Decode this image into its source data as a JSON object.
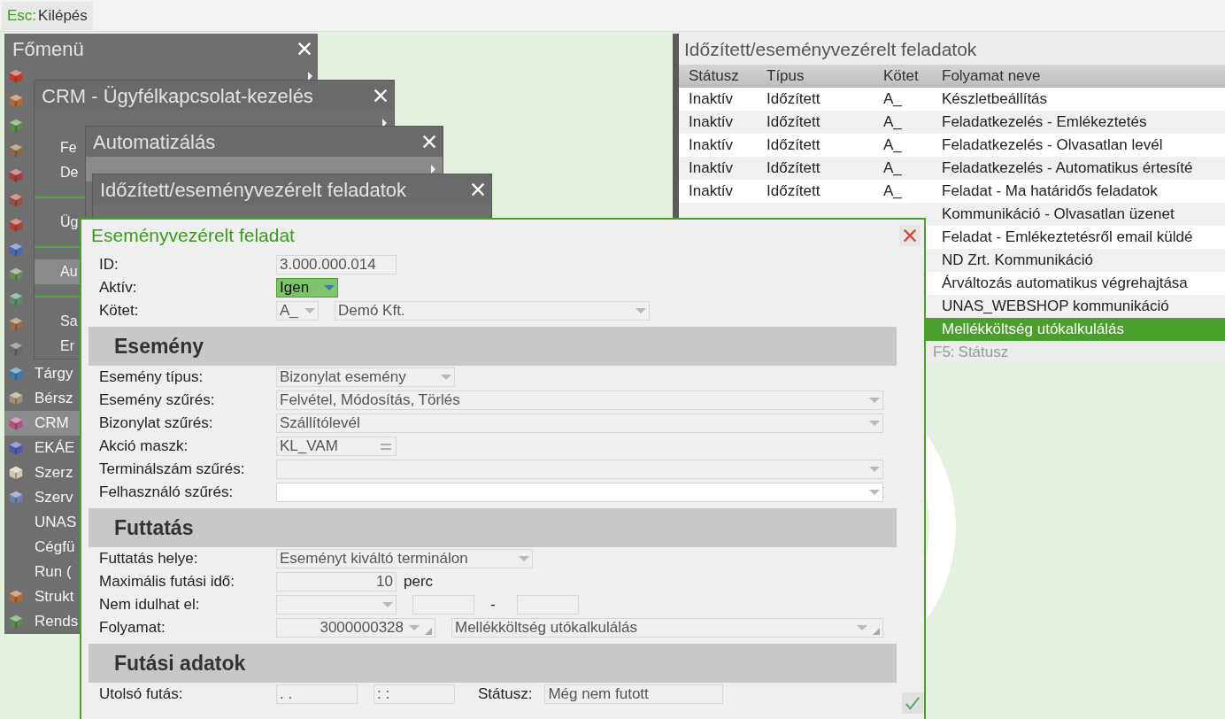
{
  "topbar": {
    "key": "Esc:",
    "label": "Kilépés"
  },
  "main_menu": {
    "title": "Főmenü",
    "items": [
      {
        "icon": true,
        "arrow": true,
        "selected": false
      },
      {
        "icon": true,
        "selected": false
      },
      {
        "icon": true,
        "selected": false
      },
      {
        "icon": true,
        "selected": false
      },
      {
        "icon": true,
        "selected": false
      },
      {
        "icon": true,
        "selected": false
      },
      {
        "icon": true,
        "selected": false
      },
      {
        "icon": true,
        "selected": false
      },
      {
        "icon": true,
        "selected": false
      },
      {
        "icon": true,
        "selected": false
      },
      {
        "icon": true,
        "selected": false
      },
      {
        "icon": true,
        "selected": false
      },
      {
        "label": "Tárgy",
        "icon": true,
        "selected": false
      },
      {
        "label": "Bérsz",
        "icon": true,
        "selected": false
      },
      {
        "label": "CRM",
        "icon": true,
        "selected": true
      },
      {
        "label": "EKÁE",
        "icon": true,
        "selected": false
      },
      {
        "label": "Szerz",
        "icon": true,
        "selected": false
      },
      {
        "label": "Szerv",
        "icon": true,
        "selected": false
      },
      {
        "label": "UNAS",
        "icon": false,
        "selected": false
      },
      {
        "label": "Cégfü",
        "icon": false,
        "selected": false
      },
      {
        "label": "Run (",
        "icon": false,
        "selected": false
      },
      {
        "label": "Strukt",
        "icon": true,
        "selected": false
      },
      {
        "label": "Rends",
        "icon": true,
        "selected": false
      }
    ]
  },
  "crm_menu": {
    "title": "CRM - Ügyfélkapcsolat-kezelés",
    "items": [
      {
        "kind": "item",
        "arrow": true,
        "selected": false
      },
      {
        "kind": "item",
        "label": "Fe",
        "selected": false
      },
      {
        "kind": "item",
        "label": "De",
        "selected": false
      },
      {
        "kind": "separator"
      },
      {
        "kind": "item",
        "label": "Üg",
        "selected": false
      },
      {
        "kind": "separator"
      },
      {
        "kind": "item",
        "label": "Au",
        "selected": true
      },
      {
        "kind": "separator"
      },
      {
        "kind": "item",
        "label": "Sa",
        "selected": false
      },
      {
        "kind": "item",
        "label": "Er",
        "selected": false
      }
    ]
  },
  "automation_menu": {
    "title": "Automatizálás",
    "items": [
      {
        "arrow": true,
        "selected": true
      }
    ]
  },
  "tasks_menu": {
    "title": "Időzített/eseményvezérelt feladatok",
    "items": [
      {
        "selected": false
      }
    ]
  },
  "task_list": {
    "title": "Időzített/eseményvezérelt feladatok",
    "columns": [
      "Státusz",
      "Típus",
      "Kötet",
      "Folyamat neve"
    ],
    "rows": [
      {
        "cells": [
          "Inaktív",
          "Időzített",
          "A_",
          "Készletbeállítás"
        ],
        "selected": false
      },
      {
        "cells": [
          "Inaktív",
          "Időzített",
          "A_",
          "Feladatkezelés - Emlékeztetés"
        ],
        "selected": false
      },
      {
        "cells": [
          "Inaktív",
          "Időzített",
          "A_",
          "Feladatkezelés - Olvasatlan levél"
        ],
        "selected": false
      },
      {
        "cells": [
          "Inaktív",
          "Időzített",
          "A_",
          "Feladatkezelés - Automatikus értesíté"
        ],
        "selected": false
      },
      {
        "cells": [
          "Inaktív",
          "Időzített",
          "A_",
          "Feladat - Ma határidős feladatok"
        ],
        "selected": false
      },
      {
        "cells": [
          null,
          null,
          null,
          "Kommunikáció - Olvasatlan üzenet"
        ],
        "selected": false
      },
      {
        "cells": [
          null,
          null,
          null,
          "Feladat - Emlékeztetésről email küldé"
        ],
        "selected": false
      },
      {
        "cells": [
          null,
          null,
          null,
          "ND Zrt. Kommunikáció"
        ],
        "selected": false
      },
      {
        "cells": [
          null,
          null,
          null,
          "Árváltozás automatikus végrehajtása"
        ],
        "selected": false
      },
      {
        "cells": [
          null,
          null,
          null,
          "UNAS_WEBSHOP kommunikáció"
        ],
        "selected": false
      },
      {
        "cells": [
          null,
          null,
          null,
          "Mellékköltség utókalkulálás"
        ],
        "selected": true
      }
    ],
    "footer": {
      "key": "F5:",
      "label": "Státusz"
    }
  },
  "dialog": {
    "title": "Eseményvezérelt feladat",
    "sections": [
      {
        "rows": [
          {
            "label": "ID:",
            "controls": [
              {
                "kind": "input",
                "value": "3.000.000.014",
                "disabled": true
              }
            ]
          },
          {
            "label": "Aktív:",
            "controls": [
              {
                "kind": "dropdown",
                "value": "Igen",
                "focused": true
              }
            ]
          },
          {
            "label": "Kötet:",
            "controls": [
              {
                "kind": "dropdown",
                "value": "A_",
                "disabled": true
              },
              {
                "kind": "dropdown",
                "value": "Demó Kft.",
                "disabled": true
              }
            ]
          }
        ]
      },
      {
        "title": "Esemény",
        "rows": [
          {
            "label": "Esemény típus:",
            "controls": [
              {
                "kind": "dropdown",
                "value": "Bizonylat esemény",
                "disabled": true
              }
            ]
          },
          {
            "label": "Esemény szűrés:",
            "controls": [
              {
                "kind": "dropdown",
                "value": "Felvétel, Módosítás, Törlés",
                "disabled": true
              }
            ]
          },
          {
            "label": "Bizonylat szűrés:",
            "controls": [
              {
                "kind": "dropdown",
                "value": "Szállítólevél",
                "disabled": true
              }
            ]
          },
          {
            "label": "Akció maszk:",
            "controls": [
              {
                "kind": "mask",
                "value": "KL_VAM",
                "disabled": true
              }
            ]
          },
          {
            "label": "Terminálszám szűrés:",
            "controls": [
              {
                "kind": "dropdown",
                "disabled": true
              }
            ]
          },
          {
            "label": "Felhasználó szűrés:",
            "controls": [
              {
                "kind": "dropdown",
                "disabled": false
              }
            ]
          }
        ]
      },
      {
        "title": "Futtatás",
        "rows": [
          {
            "label": "Futtatás helye:",
            "controls": [
              {
                "kind": "dropdown",
                "value": "Eseményt kiváltó terminálon",
                "disabled": true
              }
            ]
          },
          {
            "label": "Maximális futási idő:",
            "controls": [
              {
                "kind": "input",
                "value": "10",
                "disabled": true
              },
              {
                "kind": "text",
                "value": "perc"
              }
            ]
          },
          {
            "label": "Nem idulhat el:",
            "controls": [
              {
                "kind": "dropdown",
                "disabled": true
              },
              {
                "kind": "input",
                "disabled": true
              },
              {
                "kind": "text",
                "value": "-"
              },
              {
                "kind": "input",
                "disabled": true
              }
            ]
          },
          {
            "label": "Folyamat:",
            "controls": [
              {
                "kind": "lookup",
                "value": "3000000328",
                "disabled": true
              },
              {
                "kind": "lookup",
                "value": "Mellékköltség utókalkulálás",
                "disabled": true
              }
            ]
          }
        ]
      },
      {
        "title": "Futási adatok",
        "rows": [
          {
            "label": "Utolsó futás:",
            "controls": [
              {
                "kind": "input",
                "value": ". .",
                "disabled": true
              },
              {
                "kind": "input",
                "value": ": :",
                "disabled": true
              },
              {
                "kind": "text",
                "value": "Státusz:"
              },
              {
                "kind": "input",
                "value": "Még nem futott",
                "disabled": true
              }
            ]
          }
        ]
      }
    ]
  }
}
